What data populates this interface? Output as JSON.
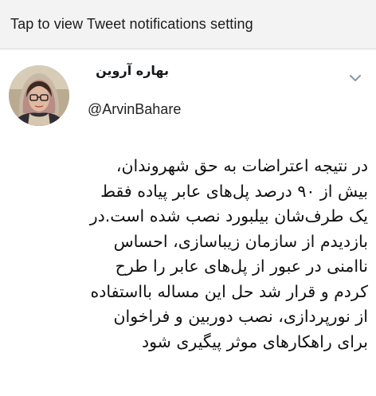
{
  "notification": {
    "text": "Tap to view Tweet notifications setting"
  },
  "tweet": {
    "display_name": "بهاره آروین",
    "handle": "@ArvinBahare",
    "caret_icon": "chevron-down-icon",
    "body_lines": [
      "در نتیجه اعتراضات به حق شهروندان،",
      "بیش از ۹۰ درصد پل‌های عابر پیاده فقط",
      "یک طرف‌شان بیلبورد نصب شده است.در",
      "بازدیدم از سازمان زیباسازی، احساس",
      "ناامنی در عبور از پل‌های عابر را طرح",
      "کردم و قرار شد حل این مساله بااستفاده",
      "از نورپردازی، نصب دوربین و فراخوان",
      "برای راهکارهای موثر پیگیری شود"
    ]
  },
  "colors": {
    "notification_bg": "#f3f3f3",
    "text": "#14171a",
    "caret": "#8899a6"
  }
}
